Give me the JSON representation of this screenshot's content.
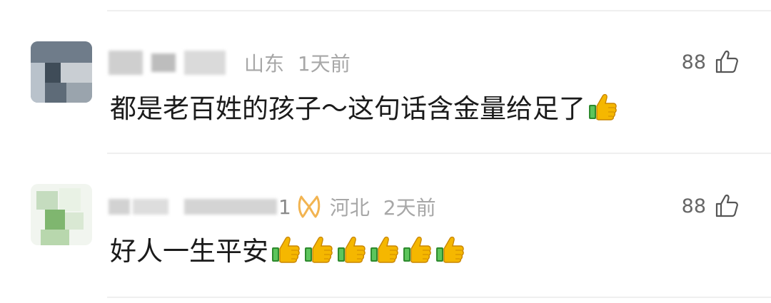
{
  "comments": [
    {
      "location": "山东",
      "time": "1天前",
      "text": "都是老百姓的孩子～这句话含金量给足了",
      "emoji_count": 1,
      "emoji_icon": "thumbs-up-emoji",
      "likes": "88",
      "like_icon": "thumbs-up-outline-icon"
    },
    {
      "name_visible_char": "1",
      "badge_icon": "ribbon-badge-icon",
      "location": "河北",
      "time": "2天前",
      "text": "好人一生平安",
      "emoji_count": 6,
      "emoji_icon": "thumbs-up-emoji",
      "likes": "88",
      "like_icon": "thumbs-up-outline-icon"
    }
  ],
  "colors": {
    "text": "#1b1b1b",
    "meta": "#a7a7a7",
    "like": "#666666",
    "divider": "#efefef",
    "badge": "#f2b451"
  }
}
